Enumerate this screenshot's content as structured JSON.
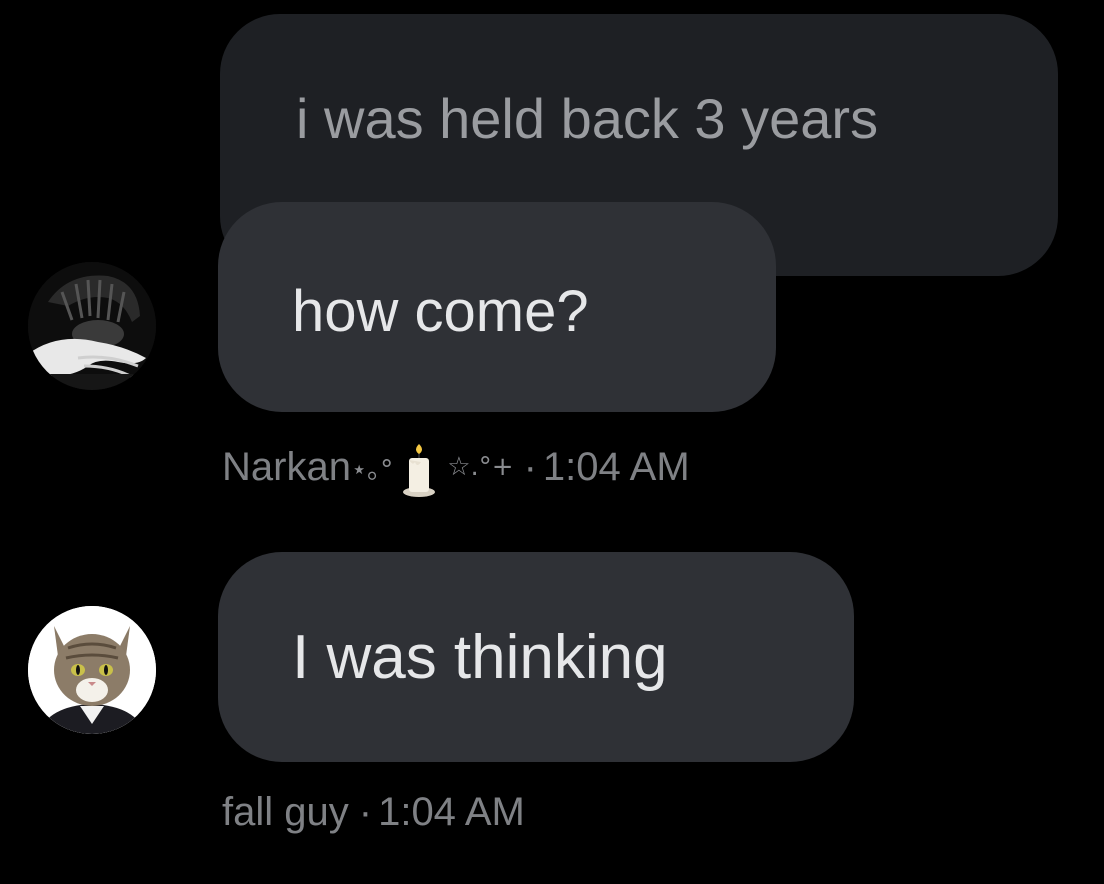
{
  "conversation": {
    "quoted_message": {
      "text": "i was held back 3 years"
    },
    "messages": [
      {
        "text": "how come?",
        "sender": "Narkan",
        "sender_decoration_left": "⋆｡°",
        "sender_decoration_right": "☆.°+",
        "sender_icon": "candle-icon",
        "separator": "·",
        "time": "1:04 AM",
        "avatar": "person-avatar"
      },
      {
        "text": "I was thinking",
        "sender": "fall guy",
        "separator": "·",
        "time": "1:04 AM",
        "avatar": "cat-avatar"
      }
    ]
  },
  "colors": {
    "background": "#000000",
    "quoted_bubble": "#1e2024",
    "message_bubble": "#2f3136",
    "meta_text": "#7f8185",
    "message_text": "#e6e7e9"
  }
}
